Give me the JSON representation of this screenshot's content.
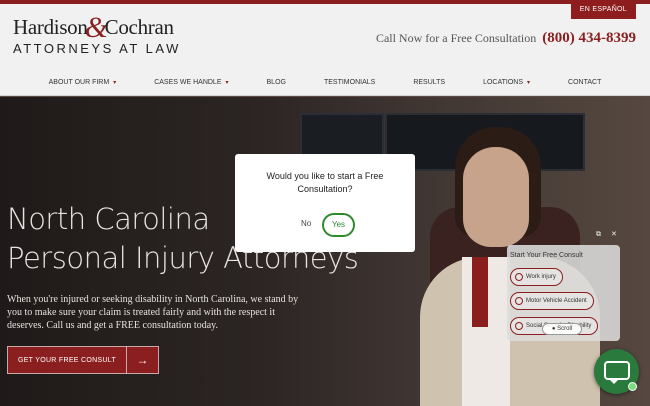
{
  "header": {
    "language_link": "EN ESPAÑOL",
    "logo_name_first": "Hardison",
    "logo_ampersand": "&",
    "logo_name_second": "Cochran",
    "logo_subtitle": "ATTORNEYS AT LAW",
    "call_text": "Call Now for a Free Consultation",
    "phone": "(800) 434-8399"
  },
  "nav": {
    "items": [
      {
        "label": "ABOUT OUR FIRM",
        "has_dropdown": true
      },
      {
        "label": "CASES WE HANDLE",
        "has_dropdown": true
      },
      {
        "label": "BLOG",
        "has_dropdown": false
      },
      {
        "label": "TESTIMONIALS",
        "has_dropdown": false
      },
      {
        "label": "RESULTS",
        "has_dropdown": false
      },
      {
        "label": "LOCATIONS",
        "has_dropdown": true
      },
      {
        "label": "CONTACT",
        "has_dropdown": false
      }
    ],
    "caret": "▾"
  },
  "hero": {
    "title_line1": "North Carolina",
    "title_line2": "Personal Injury Attorneys",
    "text": "When you're injured or seeking disability in North Carolina, we stand by you to make sure your claim is treated fairly and with the respect it deserves. Call us and get a FREE consultation today.",
    "cta_label": "GET YOUR FREE CONSULT",
    "cta_arrow": "→"
  },
  "modal": {
    "question": "Would you like to start a Free Consultation?",
    "no_label": "No",
    "yes_label": "Yes"
  },
  "chat": {
    "title": "Start Your Free Consult",
    "options": [
      "Work injury",
      "Motor Vehicle Accident",
      "Social Security Disability"
    ],
    "popout_icon": "⧉",
    "close_icon": "✕",
    "scroll_label": "Scroll"
  },
  "colors": {
    "brand": "#8b1f1f",
    "chat_green": "#2a7a3e"
  }
}
